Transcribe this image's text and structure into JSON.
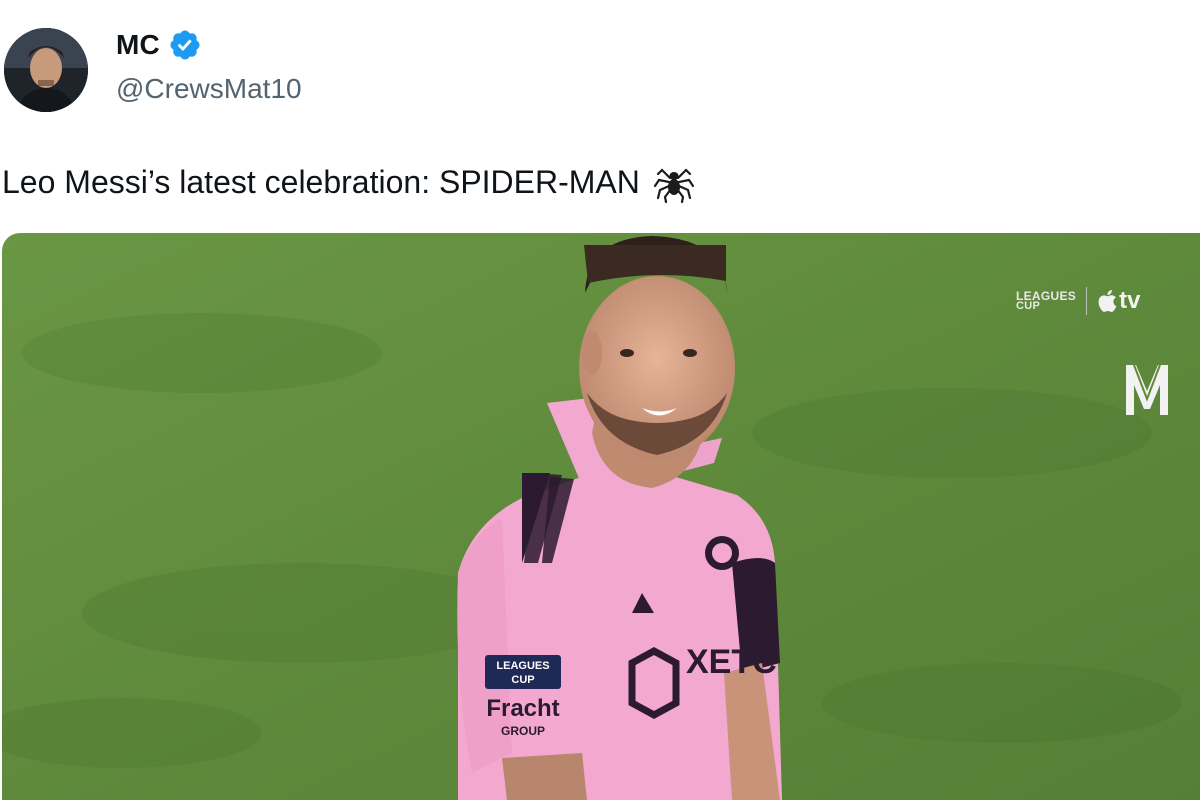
{
  "tweet": {
    "author": {
      "display_name": "MC",
      "handle": "@CrewsMat10",
      "verified": true,
      "avatar_icon": "profile-photo"
    },
    "text": "Leo Messi’s latest celebration: SPIDER-MAN",
    "emoji_icon": "spider-icon",
    "media": {
      "broadcast_logo": {
        "leagues_cup_top": "LEAGUES",
        "leagues_cup_bottom": "CUP",
        "tv_label": "tv"
      },
      "jersey": {
        "patch_top": "LEAGUES",
        "patch_bottom": "CUP",
        "sponsor_sleeve": "Fracht",
        "sponsor_sleeve_sub": "GROUP",
        "sponsor_chest": "XETC"
      }
    }
  },
  "colors": {
    "text_primary": "#0f1419",
    "text_secondary": "#536471",
    "verified_blue": "#1d9bf0",
    "pitch_green": "#5f8a3c",
    "jersey_pink": "#f3a9cf",
    "jersey_dark": "#2b1a30"
  }
}
